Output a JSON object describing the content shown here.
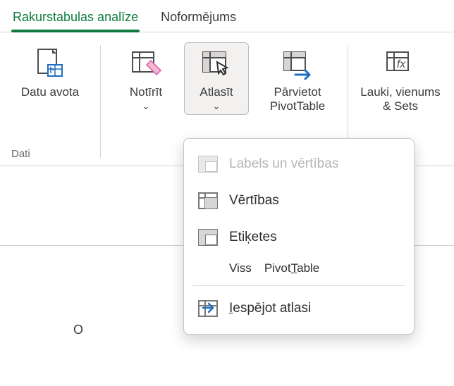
{
  "tabs": {
    "analyze": "Rakurstabulas analīze",
    "design": "Noformējums"
  },
  "ribbon": {
    "data_source": "Datu avota",
    "group_data": "Dati",
    "clear": "Notīrīt",
    "select": "Atlasīt",
    "move_line1": "Pārvietot",
    "move_line2": "PivotTable",
    "fields_line1": "Lauki, vienums",
    "fields_line2": "& Sets"
  },
  "dropdown": {
    "labels_prefix": "Labels",
    "labels_suffix": " un vērtības",
    "values": "Vērtības",
    "labels2": "Etiķetes",
    "entire_prefix": "Viss",
    "entire_pre": "Pivot",
    "entire_u": "T",
    "entire_post": "able",
    "enable_pre": "I",
    "enable_rest": "espējot atlasi"
  },
  "sheet": {
    "cell": "O"
  }
}
